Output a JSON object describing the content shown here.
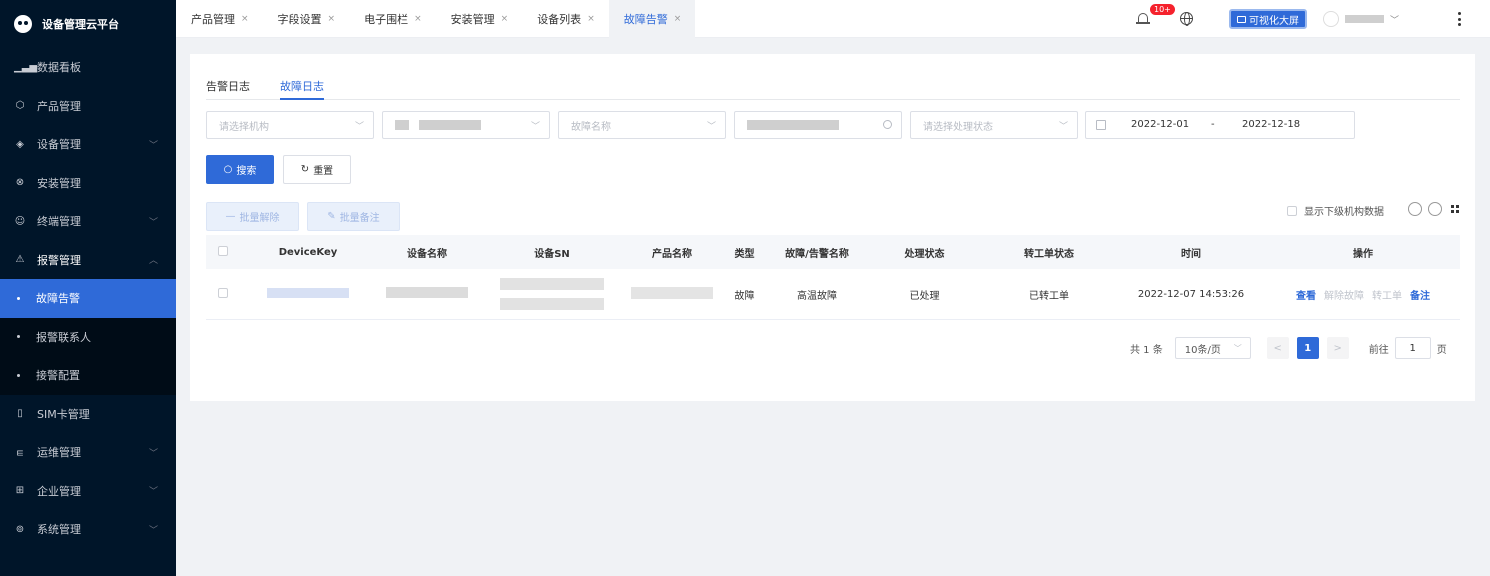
{
  "app": {
    "title": "设备管理云平台"
  },
  "sidebar": {
    "items": [
      {
        "label": "数据看板",
        "icon": "bar-chart-icon",
        "has_arrow": false
      },
      {
        "label": "产品管理",
        "icon": "cube-icon",
        "has_arrow": false
      },
      {
        "label": "设备管理",
        "icon": "layers-icon",
        "has_arrow": true
      },
      {
        "label": "安装管理",
        "icon": "wrench-icon",
        "has_arrow": false
      },
      {
        "label": "终端管理",
        "icon": "user-icon",
        "has_arrow": true
      },
      {
        "label": "报警管理",
        "icon": "alarm-icon",
        "has_arrow": true,
        "open": true
      }
    ],
    "alarm_sub": [
      {
        "label": "故障告警",
        "active": true
      },
      {
        "label": "报警联系人",
        "active": false
      },
      {
        "label": "接警配置",
        "active": false
      }
    ],
    "items_after": [
      {
        "label": "SIM卡管理",
        "icon": "sim-icon",
        "has_arrow": false
      },
      {
        "label": "运维管理",
        "icon": "tool-icon",
        "has_arrow": true
      },
      {
        "label": "企业管理",
        "icon": "building-icon",
        "has_arrow": true
      },
      {
        "label": "系统管理",
        "icon": "settings-icon",
        "has_arrow": true
      }
    ]
  },
  "topbar": {
    "tabs": [
      {
        "label": "产品管理",
        "active": false
      },
      {
        "label": "字段设置",
        "active": false
      },
      {
        "label": "电子围栏",
        "active": false
      },
      {
        "label": "安装管理",
        "active": false
      },
      {
        "label": "设备列表",
        "active": false
      },
      {
        "label": "故障告警",
        "active": true
      }
    ],
    "tab_close": "×",
    "badge": "10+",
    "vis_button": "可视化大屏"
  },
  "subtabs": {
    "alarm_log": "告警日志",
    "fault_log": "故障日志"
  },
  "filters": {
    "org_placeholder": "请选择机构",
    "fault_name_placeholder": "故障名称",
    "status_placeholder": "请选择处理状态",
    "date_start": "2022-12-01",
    "date_sep": "-",
    "date_end": "2022-12-18"
  },
  "buttons": {
    "search": "搜索",
    "reset": "重置",
    "batch_unbind": "批量解除",
    "batch_remark": "批量备注"
  },
  "toolbar": {
    "show_sub_org": "显示下级机构数据"
  },
  "table": {
    "headers": [
      "DeviceKey",
      "设备名称",
      "设备SN",
      "产品名称",
      "类型",
      "故障/告警名称",
      "处理状态",
      "转工单状态",
      "时间",
      "操作"
    ],
    "rows": [
      {
        "type": "故障",
        "fault_name": "高温故障",
        "status": "已处理",
        "ticket_status": "已转工单",
        "time": "2022-12-07 14:53:26",
        "ops": {
          "view": "查看",
          "unbind": "解除故障",
          "ticket": "转工单",
          "remark": "备注"
        }
      }
    ]
  },
  "pagination": {
    "total": "共 1 条",
    "page_size": "10条/页",
    "prev": "<",
    "current": "1",
    "next": ">",
    "goto_prefix": "前往",
    "goto_value": "1",
    "goto_suffix": "页"
  },
  "colors": {
    "primary": "#2f6ad8",
    "sidebar_bg": "#001529",
    "danger": "#f5222d"
  }
}
